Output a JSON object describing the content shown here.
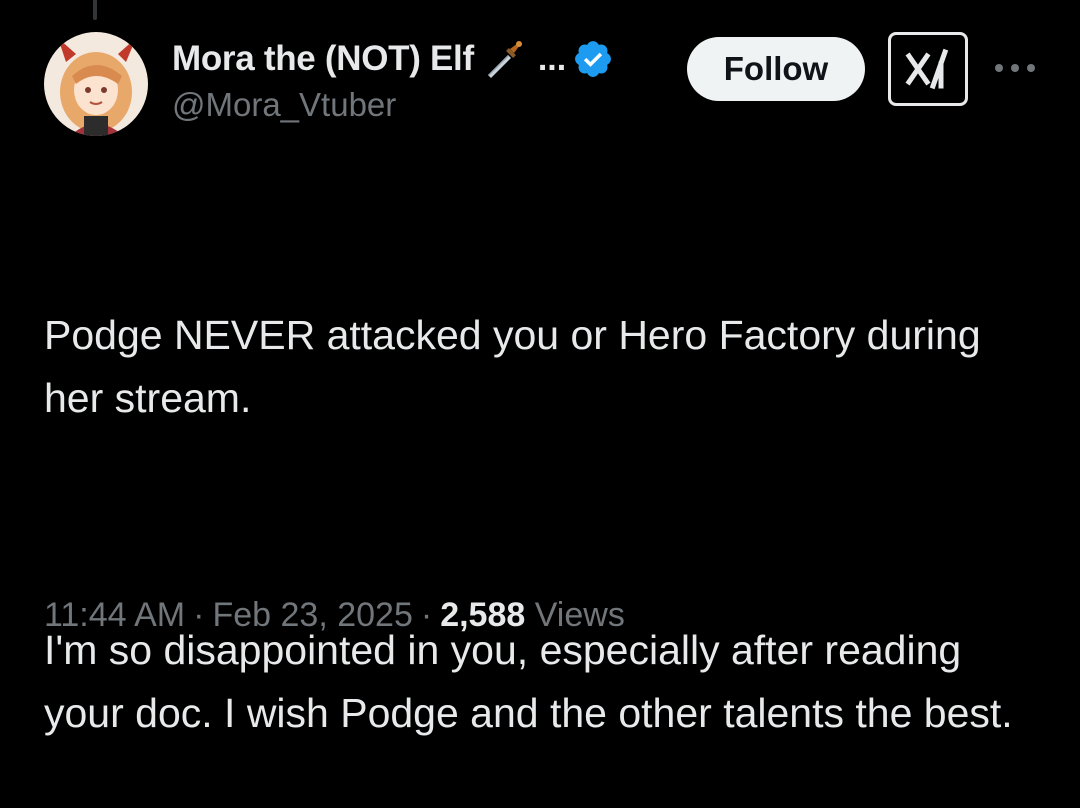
{
  "author": {
    "display_name": "Mora the (NOT) Elf",
    "name_emoji": "dagger-emoji",
    "truncation": "...",
    "verified": true,
    "verified_color": "#1d9bf0",
    "handle": "@Mora_Vtuber"
  },
  "actions": {
    "follow_label": "Follow",
    "grok_icon": "grok-icon",
    "more_icon": "more-icon"
  },
  "tweet": {
    "paragraphs": [
      "Podge NEVER attacked you or Hero Factory during her stream.",
      "I'm so disappointed in you, especially after reading your doc. I wish Podge and the other talents the best."
    ]
  },
  "meta": {
    "time": "11:44 AM",
    "separator": "·",
    "date": "Feb 23, 2025",
    "views_count": "2,588",
    "views_label": "Views"
  },
  "colors": {
    "background": "#000000",
    "text_primary": "#e7e9ea",
    "text_secondary": "#71767b",
    "follow_bg": "#eff3f4"
  }
}
